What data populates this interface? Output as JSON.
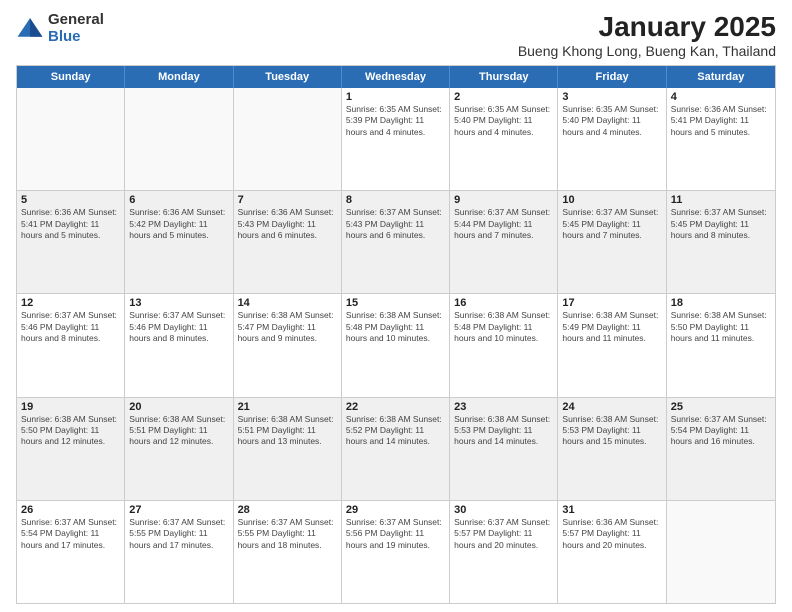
{
  "logo": {
    "general": "General",
    "blue": "Blue"
  },
  "title": "January 2025",
  "location": "Bueng Khong Long, Bueng Kan, Thailand",
  "days_of_week": [
    "Sunday",
    "Monday",
    "Tuesday",
    "Wednesday",
    "Thursday",
    "Friday",
    "Saturday"
  ],
  "weeks": [
    [
      {
        "day": "",
        "info": "",
        "empty": true
      },
      {
        "day": "",
        "info": "",
        "empty": true
      },
      {
        "day": "",
        "info": "",
        "empty": true
      },
      {
        "day": "1",
        "info": "Sunrise: 6:35 AM\nSunset: 5:39 PM\nDaylight: 11 hours and 4 minutes."
      },
      {
        "day": "2",
        "info": "Sunrise: 6:35 AM\nSunset: 5:40 PM\nDaylight: 11 hours and 4 minutes."
      },
      {
        "day": "3",
        "info": "Sunrise: 6:35 AM\nSunset: 5:40 PM\nDaylight: 11 hours and 4 minutes."
      },
      {
        "day": "4",
        "info": "Sunrise: 6:36 AM\nSunset: 5:41 PM\nDaylight: 11 hours and 5 minutes."
      }
    ],
    [
      {
        "day": "5",
        "info": "Sunrise: 6:36 AM\nSunset: 5:41 PM\nDaylight: 11 hours and 5 minutes.",
        "shaded": true
      },
      {
        "day": "6",
        "info": "Sunrise: 6:36 AM\nSunset: 5:42 PM\nDaylight: 11 hours and 5 minutes.",
        "shaded": true
      },
      {
        "day": "7",
        "info": "Sunrise: 6:36 AM\nSunset: 5:43 PM\nDaylight: 11 hours and 6 minutes.",
        "shaded": true
      },
      {
        "day": "8",
        "info": "Sunrise: 6:37 AM\nSunset: 5:43 PM\nDaylight: 11 hours and 6 minutes.",
        "shaded": true
      },
      {
        "day": "9",
        "info": "Sunrise: 6:37 AM\nSunset: 5:44 PM\nDaylight: 11 hours and 7 minutes.",
        "shaded": true
      },
      {
        "day": "10",
        "info": "Sunrise: 6:37 AM\nSunset: 5:45 PM\nDaylight: 11 hours and 7 minutes.",
        "shaded": true
      },
      {
        "day": "11",
        "info": "Sunrise: 6:37 AM\nSunset: 5:45 PM\nDaylight: 11 hours and 8 minutes.",
        "shaded": true
      }
    ],
    [
      {
        "day": "12",
        "info": "Sunrise: 6:37 AM\nSunset: 5:46 PM\nDaylight: 11 hours and 8 minutes."
      },
      {
        "day": "13",
        "info": "Sunrise: 6:37 AM\nSunset: 5:46 PM\nDaylight: 11 hours and 8 minutes."
      },
      {
        "day": "14",
        "info": "Sunrise: 6:38 AM\nSunset: 5:47 PM\nDaylight: 11 hours and 9 minutes."
      },
      {
        "day": "15",
        "info": "Sunrise: 6:38 AM\nSunset: 5:48 PM\nDaylight: 11 hours and 10 minutes."
      },
      {
        "day": "16",
        "info": "Sunrise: 6:38 AM\nSunset: 5:48 PM\nDaylight: 11 hours and 10 minutes."
      },
      {
        "day": "17",
        "info": "Sunrise: 6:38 AM\nSunset: 5:49 PM\nDaylight: 11 hours and 11 minutes."
      },
      {
        "day": "18",
        "info": "Sunrise: 6:38 AM\nSunset: 5:50 PM\nDaylight: 11 hours and 11 minutes."
      }
    ],
    [
      {
        "day": "19",
        "info": "Sunrise: 6:38 AM\nSunset: 5:50 PM\nDaylight: 11 hours and 12 minutes.",
        "shaded": true
      },
      {
        "day": "20",
        "info": "Sunrise: 6:38 AM\nSunset: 5:51 PM\nDaylight: 11 hours and 12 minutes.",
        "shaded": true
      },
      {
        "day": "21",
        "info": "Sunrise: 6:38 AM\nSunset: 5:51 PM\nDaylight: 11 hours and 13 minutes.",
        "shaded": true
      },
      {
        "day": "22",
        "info": "Sunrise: 6:38 AM\nSunset: 5:52 PM\nDaylight: 11 hours and 14 minutes.",
        "shaded": true
      },
      {
        "day": "23",
        "info": "Sunrise: 6:38 AM\nSunset: 5:53 PM\nDaylight: 11 hours and 14 minutes.",
        "shaded": true
      },
      {
        "day": "24",
        "info": "Sunrise: 6:38 AM\nSunset: 5:53 PM\nDaylight: 11 hours and 15 minutes.",
        "shaded": true
      },
      {
        "day": "25",
        "info": "Sunrise: 6:37 AM\nSunset: 5:54 PM\nDaylight: 11 hours and 16 minutes.",
        "shaded": true
      }
    ],
    [
      {
        "day": "26",
        "info": "Sunrise: 6:37 AM\nSunset: 5:54 PM\nDaylight: 11 hours and 17 minutes."
      },
      {
        "day": "27",
        "info": "Sunrise: 6:37 AM\nSunset: 5:55 PM\nDaylight: 11 hours and 17 minutes."
      },
      {
        "day": "28",
        "info": "Sunrise: 6:37 AM\nSunset: 5:55 PM\nDaylight: 11 hours and 18 minutes."
      },
      {
        "day": "29",
        "info": "Sunrise: 6:37 AM\nSunset: 5:56 PM\nDaylight: 11 hours and 19 minutes."
      },
      {
        "day": "30",
        "info": "Sunrise: 6:37 AM\nSunset: 5:57 PM\nDaylight: 11 hours and 20 minutes."
      },
      {
        "day": "31",
        "info": "Sunrise: 6:36 AM\nSunset: 5:57 PM\nDaylight: 11 hours and 20 minutes."
      },
      {
        "day": "",
        "info": "",
        "empty": true
      }
    ]
  ]
}
